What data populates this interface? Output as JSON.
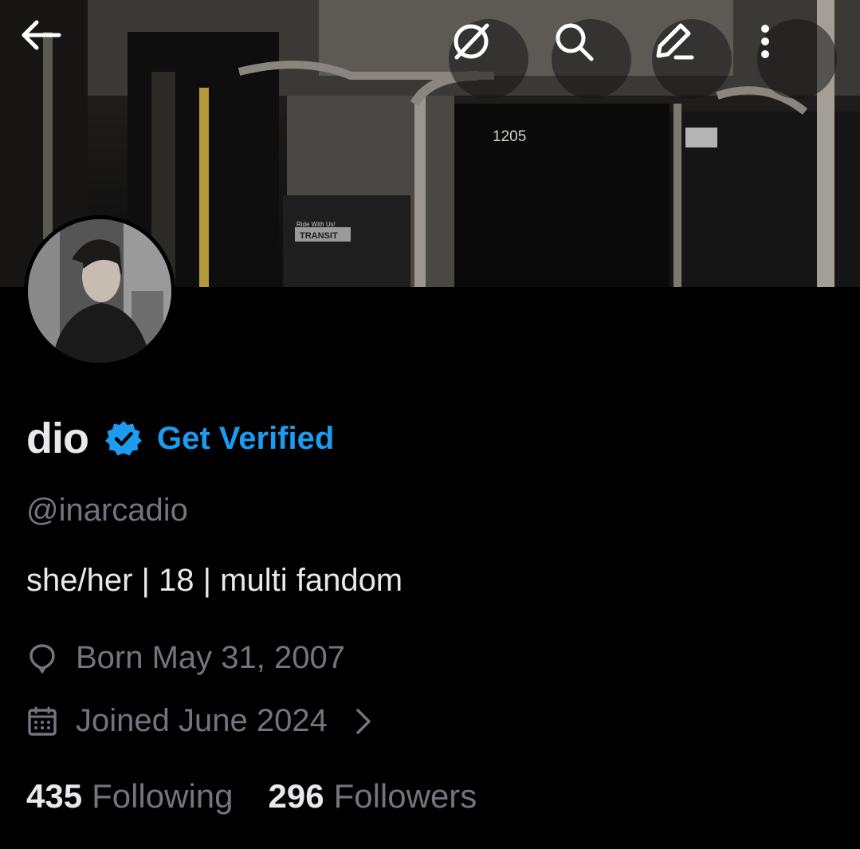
{
  "profile": {
    "display_name": "dio",
    "verify_cta": "Get Verified",
    "handle": "@inarcadio",
    "bio": "she/her | 18 | multi fandom",
    "birth": "Born May 31, 2007",
    "joined": "Joined June 2024",
    "following_count": "435",
    "following_label": "Following",
    "followers_count": "296",
    "followers_label": "Followers"
  },
  "banner": {
    "printed_text": [
      "1205",
      "TRANSIT",
      "Ride With Us!"
    ]
  },
  "icons": {
    "back": "arrow-left-icon",
    "grok": "grok-icon",
    "search": "search-icon",
    "edit": "edit-icon",
    "more": "more-vertical-icon",
    "verified": "verified-badge-icon",
    "birth": "balloon-icon",
    "calendar": "calendar-icon",
    "chevron": "chevron-right-icon"
  },
  "colors": {
    "background": "#000000",
    "primary_text": "#e7e9ea",
    "secondary_text": "#71767b",
    "accent": "#1d9bf0"
  }
}
